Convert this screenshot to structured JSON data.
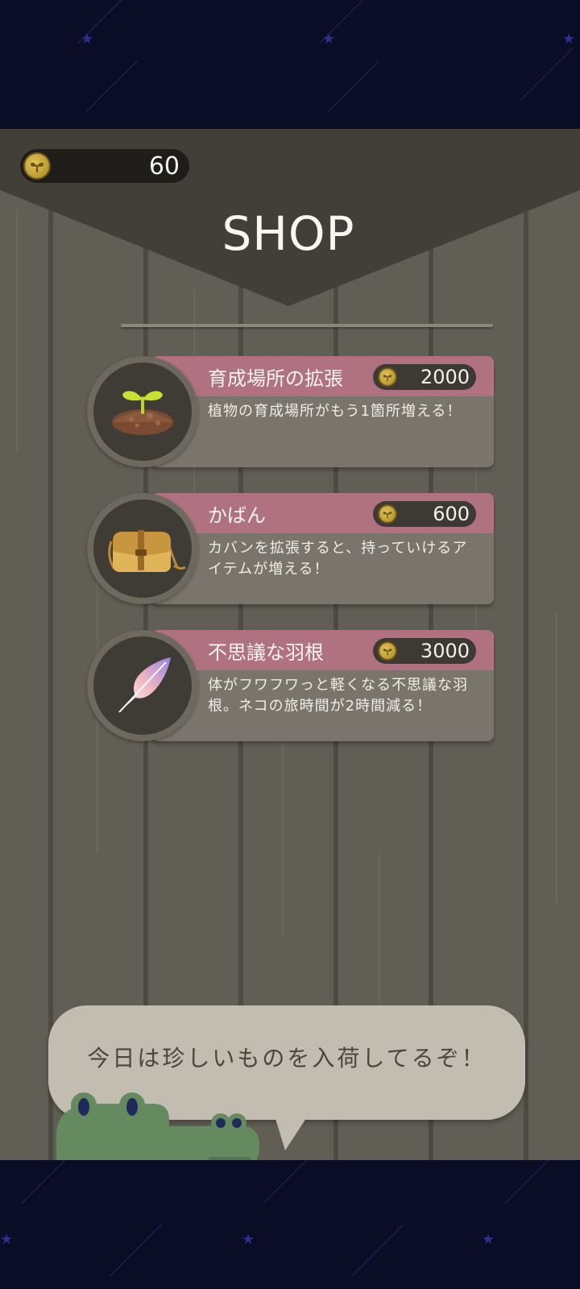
{
  "header": {
    "coin_count": "60",
    "title": "SHOP"
  },
  "items": [
    {
      "name": "育成場所の拡張",
      "price": "2000",
      "description": "植物の育成場所がもう1箇所増える！",
      "icon": "sprout-soil-icon"
    },
    {
      "name": "かばん",
      "price": "600",
      "description": "カバンを拡張すると、持っていけるアイテムが増える！",
      "icon": "bag-icon"
    },
    {
      "name": "不思議な羽根",
      "price": "3000",
      "description": "体がフワフワっと軽くなる不思議な羽根。ネコの旅時間が2時間減る！",
      "icon": "feather-icon"
    }
  ],
  "shopkeeper": {
    "message": "今日は珍しいものを入荷してるぞ！"
  },
  "colors": {
    "card_header": "#b07280",
    "close_button": "#9e7a4a",
    "banner": "#423f38",
    "space": "#0b0c26"
  }
}
